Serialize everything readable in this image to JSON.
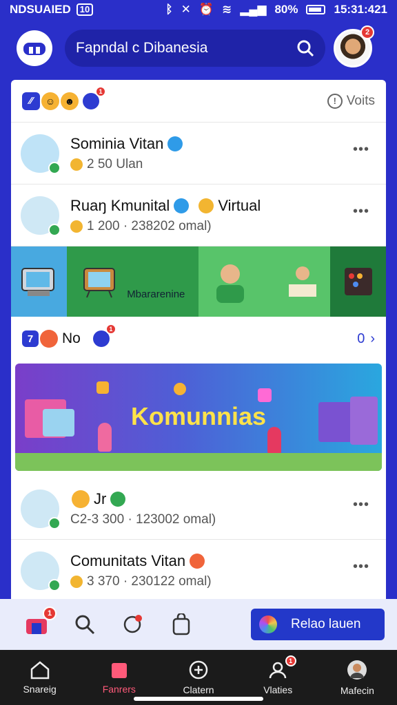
{
  "status_bar": {
    "carrier": "NDSUAIED",
    "box_num": "10",
    "battery": "80%",
    "time": "15:31:421"
  },
  "header": {
    "search_text": "Fapndal c Dibanesia",
    "avatar_badge": "2"
  },
  "filter_row": {
    "badge": "1",
    "votes_label": "Voits"
  },
  "posts": [
    {
      "name": "Sominia Vitan",
      "sub": "2 50 Ulan"
    },
    {
      "name": "Ruaŋ Kmunital",
      "extra": "Virtual",
      "sub": "1 200 · 238202 omal)"
    },
    {
      "name": "Jr",
      "sub": "C2-3 300 · 123002 omal)"
    },
    {
      "name": "Comunitats Vitan",
      "sub": "3 370 · 230122 omal)"
    }
  ],
  "banner1": {
    "label": "Mbararenine"
  },
  "section": {
    "label": "No",
    "badge": "1",
    "count": "0"
  },
  "banner2": {
    "title": "Komunnias"
  },
  "actions": {
    "home_badge": "1",
    "primary_label": "Relao lauen"
  },
  "bottom_nav": [
    {
      "label": "Snareig",
      "icon": "home-icon"
    },
    {
      "label": "Fanrers",
      "icon": "bookmark-icon"
    },
    {
      "label": "Clatern",
      "icon": "add-icon"
    },
    {
      "label": "Vlaties",
      "icon": "profile-icon",
      "badge": "1"
    },
    {
      "label": "Mafecin",
      "icon": "avatar-icon"
    }
  ],
  "colors": {
    "primary": "#2a2fc9",
    "accent": "#2338c9",
    "badge": "#e53935"
  }
}
